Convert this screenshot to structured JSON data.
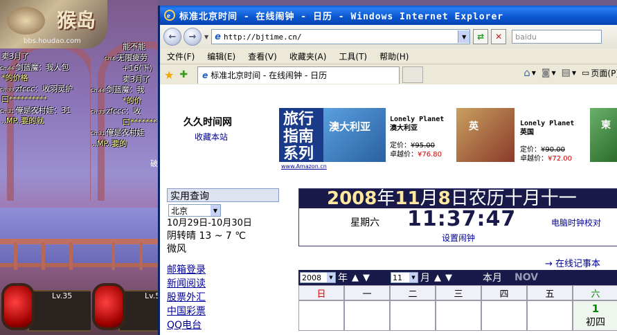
{
  "game": {
    "logo_text": "猴岛",
    "logo_url": "bbs.houdao.com",
    "chat_left": [
      {
        "tag": "",
        "text": "卖3月了"
      },
      {
        "tag": "Ch.44",
        "text": "剑蓝魔：我人包"
      },
      {
        "tag": "",
        "text": "*的价格"
      },
      {
        "tag": "Ch.33",
        "text": "zfccc：收羽灵护"
      },
      {
        "tag": "",
        "text": "口**********"
      },
      {
        "tag": "Ch.31",
        "text": "俺是农村娃：31"
      },
      {
        "tag": "",
        "text": "..MP..要的就"
      }
    ],
    "chat_right": [
      {
        "tag": "",
        "text": "能不能"
      },
      {
        "tag": "Ch.6",
        "text": "无限疲劳"
      },
      {
        "tag": "",
        "text": "+16(下)"
      },
      {
        "tag": "",
        "text": "卖3月了"
      },
      {
        "tag": "Ch.44",
        "text": "剑蓝魔：我"
      },
      {
        "tag": "",
        "text": "*的价"
      },
      {
        "tag": "Ch.33",
        "text": "zfccc：收"
      },
      {
        "tag": "",
        "text": "口*******"
      },
      {
        "tag": "Ch.31",
        "text": "俺是农村娃"
      },
      {
        "tag": "",
        "text": "..MP..要的"
      }
    ],
    "side_char": "破",
    "level_left": "Lv.35",
    "level_right": "Lv.5"
  },
  "window": {
    "title": "标准北京时间 - 在线闹钟 - 日历 - Windows Internet Explorer",
    "address": "http://bjtime.cn/",
    "search_placeholder": "baidu",
    "menu": [
      "文件(F)",
      "编辑(E)",
      "查看(V)",
      "收藏夹(A)",
      "工具(T)",
      "帮助(H)"
    ],
    "tab_title": "标准北京时间 - 在线闹钟 - 日历",
    "page_menu": "页面(P)"
  },
  "page": {
    "site_name": "久久时间网",
    "favorite_link": "收藏本站",
    "ad": {
      "book1_title": "旅行指南系列",
      "book1_sub": "澳大利亚",
      "book1_brand": "Lonely Planet",
      "book1_name": "澳大利亚",
      "book1_list_label": "定价：",
      "book1_list_price": "¥95.00",
      "book1_sale_label": "卓越价：",
      "book1_sale_price": "¥76.80",
      "book2_sub": "英",
      "book2_brand": "Lonely Planet",
      "book2_name": "英国",
      "book2_list_label": "定价：",
      "book2_list_price": "¥90.00",
      "book2_sale_label": "卓越价：",
      "book2_sale_price": "¥72.00",
      "book3_sub": "柬",
      "source": "www.Amazon.cn"
    },
    "side": {
      "header": "实用查询",
      "city": "北京",
      "date_range": "10月29日-10月30日",
      "weather": "阴转晴  13 ~ 7 ℃",
      "wind": "微风",
      "links": [
        "邮箱登录",
        "新闻阅读",
        "股票外汇",
        "中国彩票",
        "QQ电台"
      ]
    },
    "date": {
      "year": "2008",
      "y_label": "年",
      "month": "11",
      "m_label": "月",
      "day": "8",
      "d_label": "日农历十月十一",
      "weekday": "星期六",
      "time": "11:37:47",
      "sync_link": "电脑时钟校对",
      "alarm_link": "设置闹钟"
    },
    "memo_link": "→ 在线记事本",
    "calendar": {
      "year": "2008",
      "year_label": "年",
      "month": "11",
      "month_label": "月",
      "current_label": "本月",
      "current_month": "NOV",
      "weekdays": [
        "日",
        "一",
        "二",
        "三",
        "四",
        "五",
        "六"
      ],
      "first_day_num": "1",
      "first_day_lunar": "初四"
    }
  }
}
